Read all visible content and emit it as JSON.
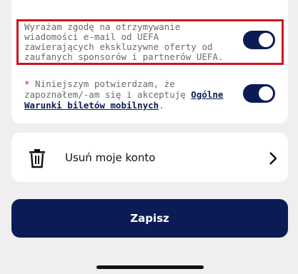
{
  "consent": {
    "marketing_text": "Wyrażam zgodę na otrzymywanie wiadomości e-mail od UEFA zawierających ekskluzywne oferty od zaufanych sponsorów i partnerów UEFA.",
    "marketing_on": true,
    "terms_required_mark": "*",
    "terms_text_before": " Niniejszym potwierdzam, że zapoznałem/-am się i akceptuję ",
    "terms_link": "Ogólne Warunki biletów mobilnych",
    "terms_text_after": ".",
    "terms_on": true
  },
  "account": {
    "delete_label": "Usuń moje konto",
    "delete_icon": "trash-icon",
    "chevron_icon": "chevron-right-icon"
  },
  "actions": {
    "save_label": "Zapisz"
  },
  "colors": {
    "accent": "#0b1b55",
    "highlight_border": "#d0121b",
    "required": "#d0121b"
  }
}
